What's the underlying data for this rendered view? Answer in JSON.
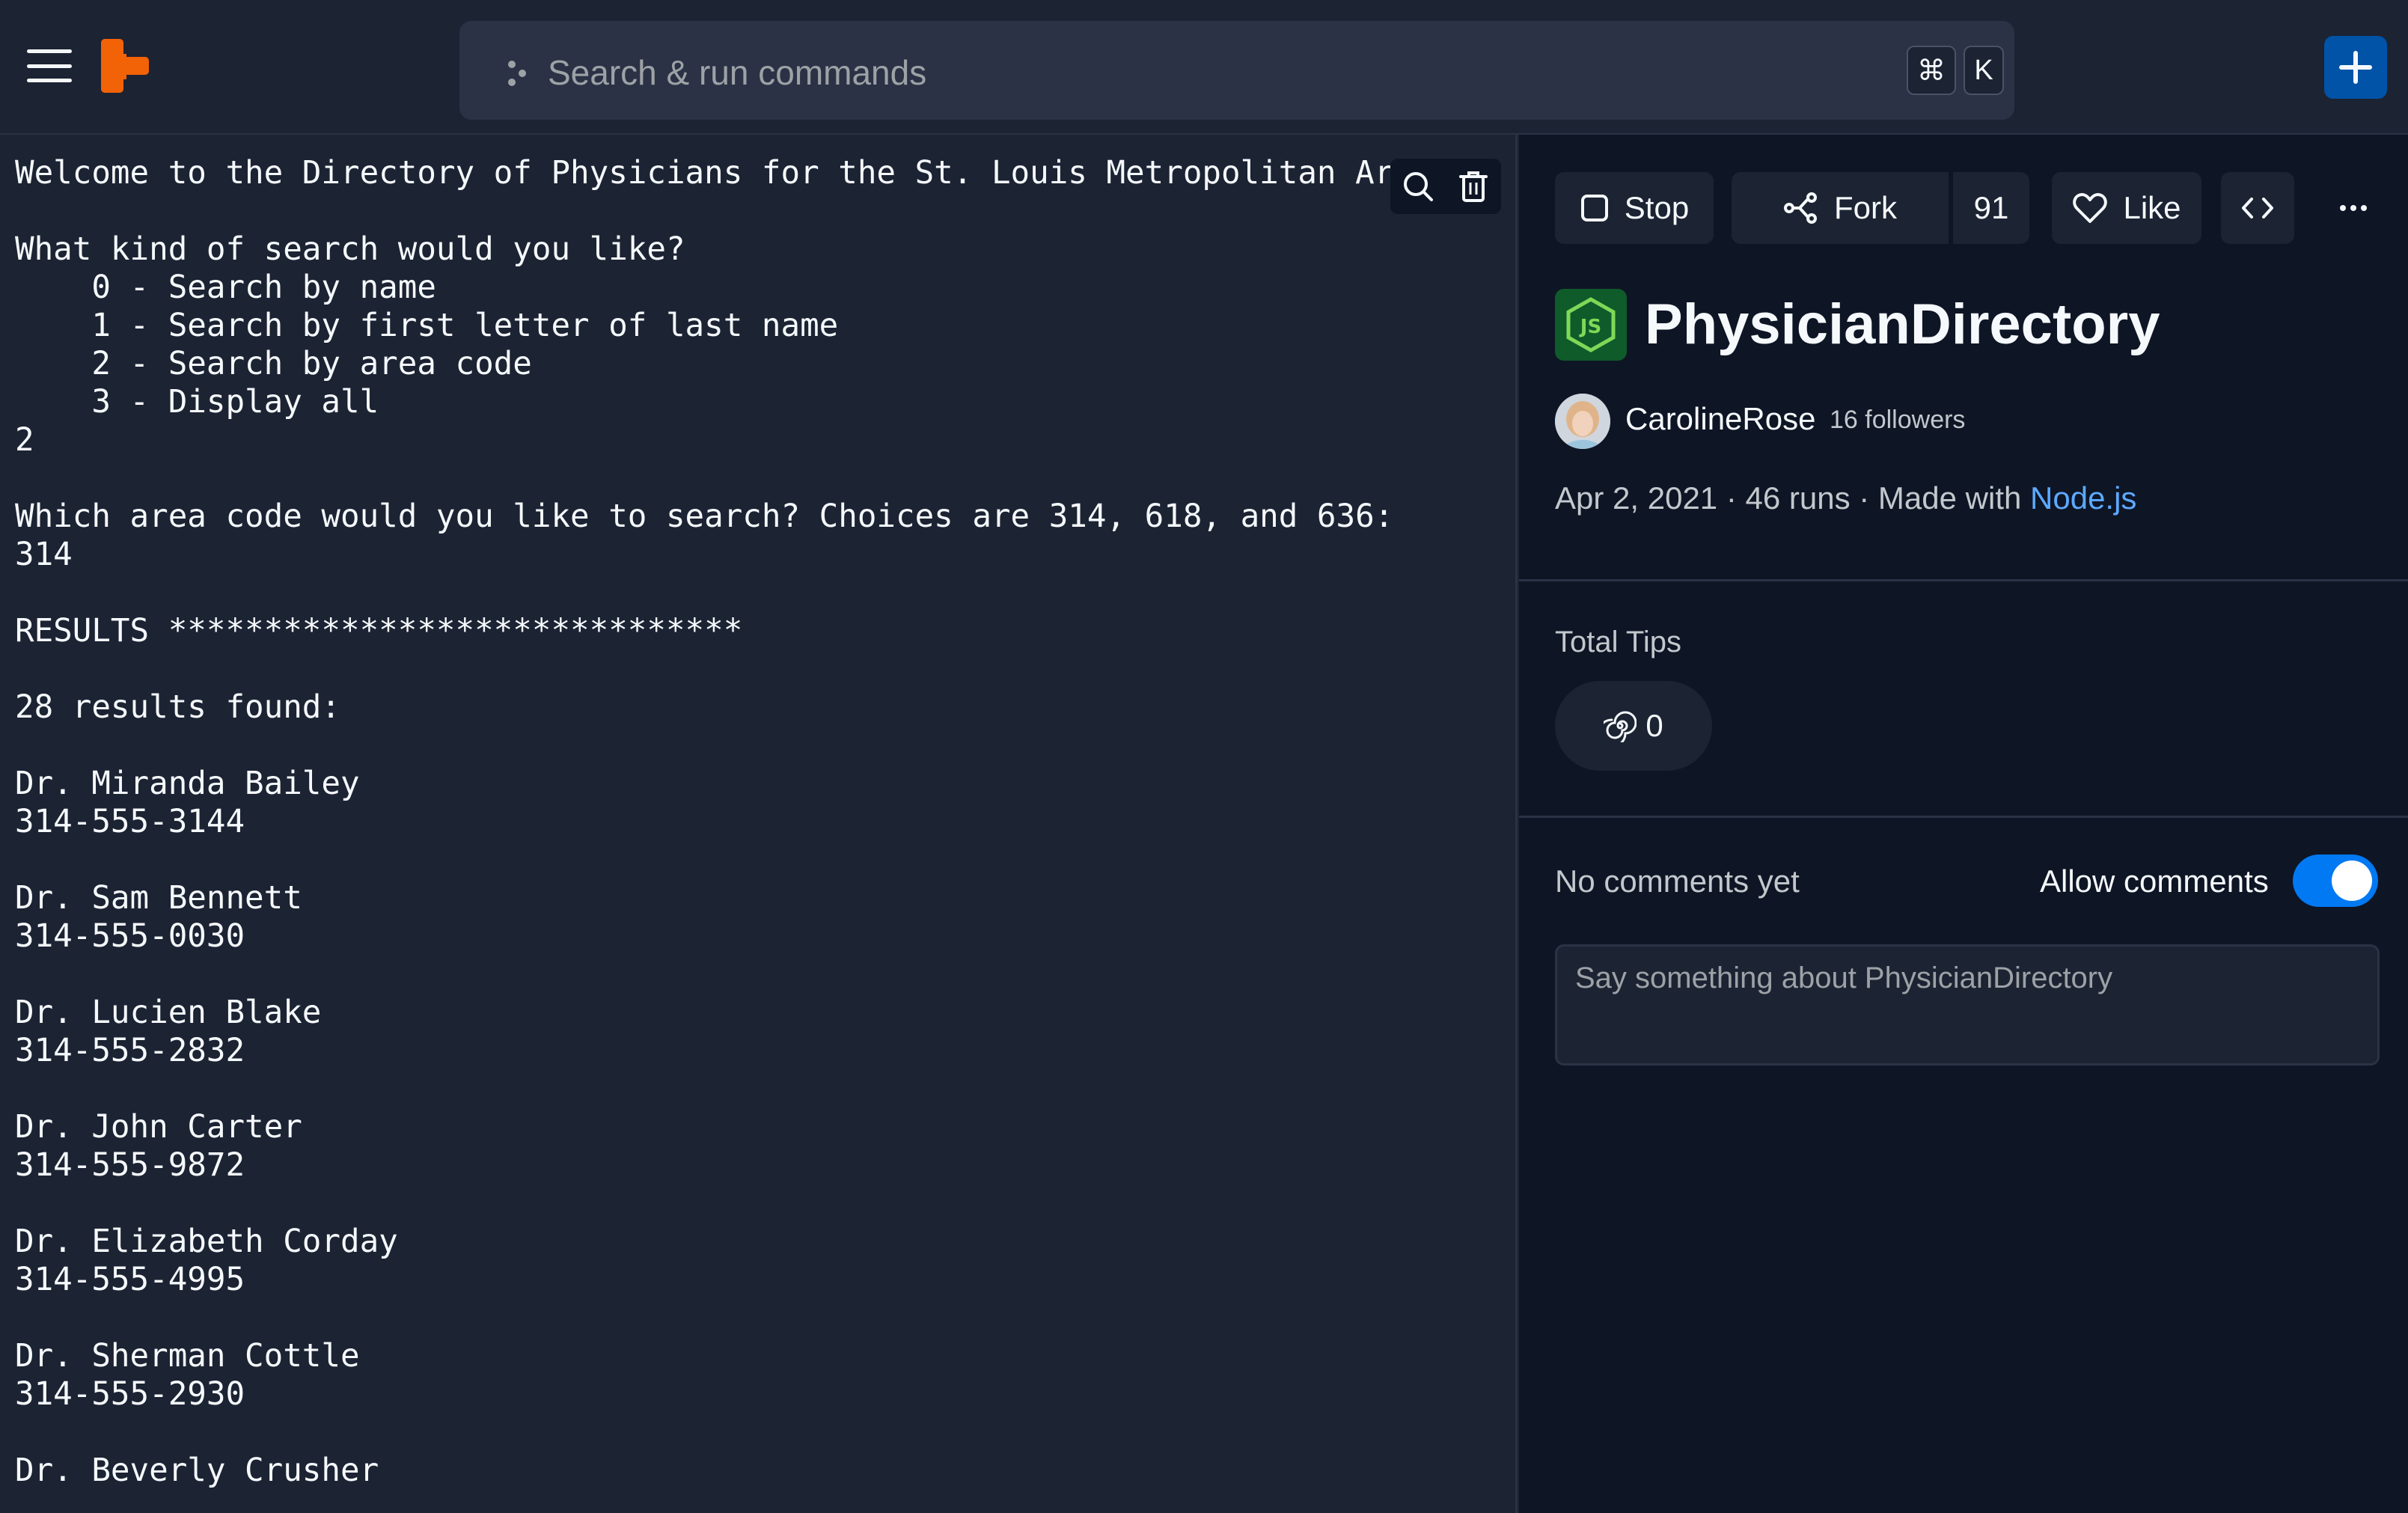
{
  "header": {
    "search_placeholder": "Search & run commands",
    "shortcut_cmd": "⌘",
    "shortcut_key": "K"
  },
  "console": {
    "lines": [
      "Welcome to the Directory of Physicians for the St. Louis Metropolitan Area",
      "",
      "What kind of search would you like?",
      "    0 - Search by name",
      "    1 - Search by first letter of last name",
      "    2 - Search by area code",
      "    3 - Display all",
      "2",
      "",
      "Which area code would you like to search? Choices are 314, 618, and 636:",
      "314",
      "",
      "RESULTS ******************************",
      "",
      "28 results found:",
      "",
      "Dr. Miranda Bailey",
      "314-555-3144",
      "",
      "Dr. Sam Bennett",
      "314-555-0030",
      "",
      "Dr. Lucien Blake",
      "314-555-2832",
      "",
      "Dr. John Carter",
      "314-555-9872",
      "",
      "Dr. Elizabeth Corday",
      "314-555-4995",
      "",
      "Dr. Sherman Cottle",
      "314-555-2930",
      "",
      "Dr. Beverly Crusher"
    ]
  },
  "actions": {
    "stop_label": "Stop",
    "fork_label": "Fork",
    "fork_count": "91",
    "like_label": "Like"
  },
  "repl": {
    "title": "PhysicianDirectory",
    "author": "CarolineRose",
    "followers": "16 followers",
    "date": "Apr 2, 2021",
    "runs": "46 runs",
    "made_with_prefix": "Made with",
    "language": "Node.js"
  },
  "tips": {
    "label": "Total Tips",
    "count": "0"
  },
  "comments": {
    "status": "No comments yet",
    "allow_label": "Allow comments",
    "allow_enabled": true,
    "placeholder": "Say something about PhysicianDirectory"
  },
  "colors": {
    "background": "#1c2333",
    "panel": "#0e1525",
    "accent_blue": "#0079f2",
    "logo_orange": "#f26207",
    "link": "#5da9ff"
  }
}
